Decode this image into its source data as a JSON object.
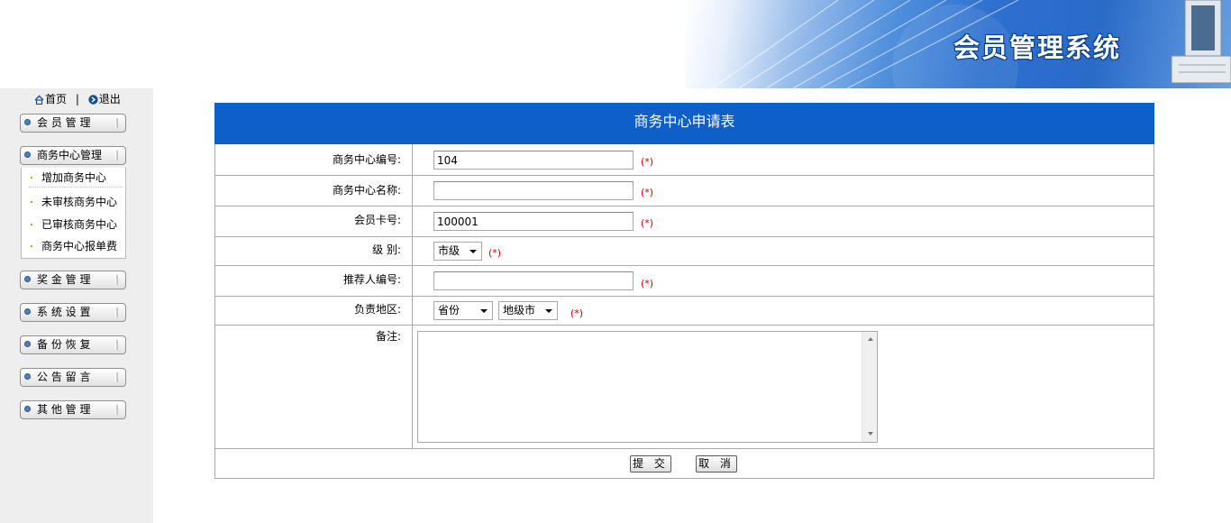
{
  "header": {
    "title": "会员管理系统"
  },
  "sidebar": {
    "home_label": "首页",
    "separator": "|",
    "logout_label": "退出",
    "menu": [
      {
        "label": "会 员 管 理"
      },
      {
        "label": "商务中心管理",
        "expanded": true,
        "items": [
          "增加商务中心",
          "未审核商务中心",
          "已审核商务中心",
          "商务中心报单费"
        ]
      },
      {
        "label": "奖 金 管 理"
      },
      {
        "label": "系 统 设 置"
      },
      {
        "label": "备 份 恢 复"
      },
      {
        "label": "公 告 留 言"
      },
      {
        "label": "其 他 管 理"
      }
    ]
  },
  "form": {
    "title": "商务中心申请表",
    "required_mark": "(*)",
    "fields": {
      "center_no": {
        "label": "商务中心编号:",
        "value": "104"
      },
      "center_name": {
        "label": "商务中心名称:",
        "value": ""
      },
      "member_card": {
        "label": "会员卡号:",
        "value": "100001"
      },
      "level": {
        "label": "级 别:",
        "selected": "市级"
      },
      "referrer_no": {
        "label": "推荐人编号:",
        "value": ""
      },
      "region": {
        "label": "负责地区:",
        "province": "省份",
        "city": "地级市"
      },
      "remark": {
        "label": "备注:",
        "value": ""
      }
    },
    "submit_label": "提 交",
    "cancel_label": "取 消"
  },
  "colors": {
    "form_header": "#0f5fc9",
    "sidebar_bg": "#eeeeee",
    "required": "#d00000"
  }
}
